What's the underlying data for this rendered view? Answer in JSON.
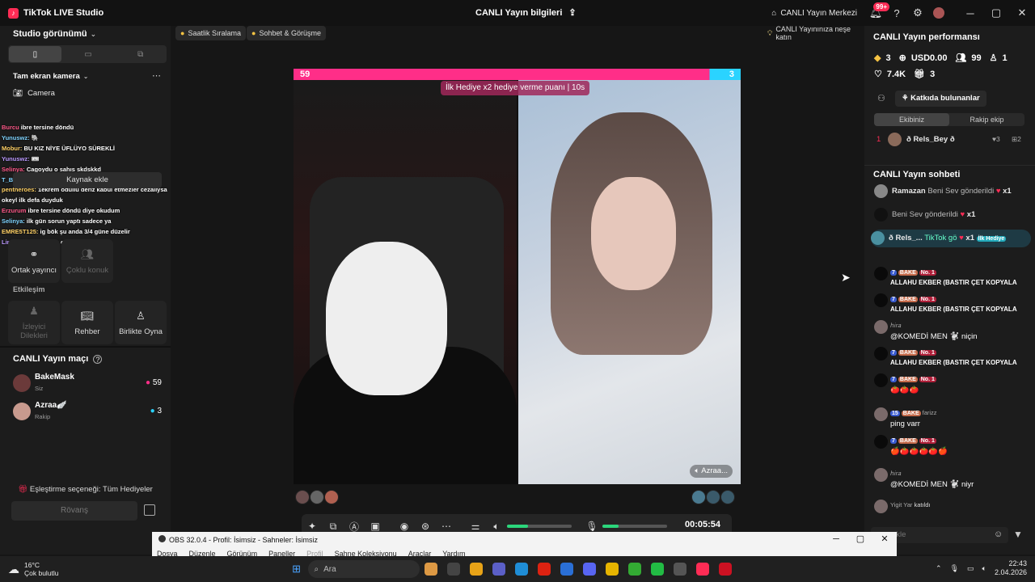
{
  "app": {
    "title": "TikTok LIVE Studio",
    "center_title": "CANLI Yayın bilgileri",
    "center_icon": "share-icon",
    "center_btn": "CANLI Yayın Merkezi",
    "notif_count": "99+"
  },
  "left": {
    "view_label": "Studio görünümü",
    "camera_section": "Tam ekran kamera",
    "camera_item": "Camera",
    "add_source": "Kaynak ekle",
    "chat_overlay": [
      {
        "user": "Burcu",
        "text": "ibre tersine döndü"
      },
      {
        "user": "Yunuswz:",
        "text": "🐘"
      },
      {
        "user": "Mobur:",
        "text": "BU KIZ NİYE ÜFLÜYO SÜREKLİ"
      },
      {
        "user": "Yunuswz:",
        "text": "🎟"
      },
      {
        "user": "Selinya:",
        "text": "Cagoydu o sahıs skdskkd"
      },
      {
        "user": "T_Bag!",
        "text": "🎟"
      },
      {
        "user": "pentheroes:",
        "text": "1ekrem ödüllü deriz kabul etmezler cezalıysa"
      },
      {
        "user": "",
        "text": "okeyl ilk defa duyduk"
      },
      {
        "user": "Erzurum",
        "text": "ibre tersine döndü diye okudum"
      },
      {
        "user": "Selinya:",
        "text": "ilk gün sorun yaptı sadece ya"
      },
      {
        "user": "EMRE5T125:",
        "text": "ig bök şu anda 3/4 güne düzelir"
      },
      {
        "user": "Linos61:",
        "text": "kovamayız o zamn"
      }
    ],
    "tiles_row1": [
      {
        "label": "Ortak yayıncı",
        "icon": "link-icon"
      },
      {
        "label": "Çoklu konuk",
        "icon": "multi-guest-icon"
      }
    ],
    "interaction_title": "Etkileşim",
    "tiles_row2": [
      {
        "label": "İzleyici Dilekleri",
        "icon": "wish-icon"
      },
      {
        "label": "Rehber",
        "icon": "book-icon"
      },
      {
        "label": "Birlikte Oyna",
        "icon": "play-together-icon"
      }
    ],
    "match_title": "CANLI Yayın maçı",
    "players": [
      {
        "name": "BakeMask",
        "role": "Siz",
        "score": "59"
      },
      {
        "name": "Azraa🪽",
        "role": "Rakip",
        "score": "3"
      }
    ],
    "match_option": "Eşleştirme seçeneği: Tüm Hediyeler",
    "rematch": "Rövanş"
  },
  "top_chips": [
    {
      "label": "Saatlik Sıralama",
      "icon": "crown-icon"
    },
    {
      "label": "Sohbet & Görüşme",
      "icon": "chat-icon"
    }
  ],
  "tip_chip": "CANLI Yayınınıza neşe katın",
  "stage": {
    "score_left": "59",
    "score_right": "3",
    "gift_banner": "İlk Hediye x2 hediye verme puanı | 10s",
    "guest_label": "Azraa..."
  },
  "control": {
    "timer": "00:05:54",
    "volume": 0.33,
    "mic": 0.25
  },
  "right": {
    "perf_title": "CANLI Yayın performansı",
    "stats_row1": [
      {
        "icon": "diamond-icon",
        "value": "3"
      },
      {
        "icon": "coin-icon",
        "value": "USD0.00"
      },
      {
        "icon": "viewers-icon",
        "value": "99"
      },
      {
        "icon": "follower-icon",
        "value": "1"
      }
    ],
    "stats_row2": [
      {
        "icon": "heart-icon",
        "value": "7.4K"
      },
      {
        "icon": "gift-icon",
        "value": "3"
      }
    ],
    "contrib_btn": "Katkıda bulunanlar",
    "team_tabs": [
      "Ekibiniz",
      "Rakip ekip"
    ],
    "contributor": {
      "rank": "1",
      "name": "ð Rels_Bey ð",
      "likes": "3",
      "gifts": "2"
    },
    "chat_title": "CANLI Yayın sohbeti",
    "gift_feed": [
      {
        "user": "Ramazan",
        "text": "Beni Sev gönderildi",
        "count": "x1"
      },
      {
        "user": "",
        "text": "Beni Sev gönderildi",
        "count": "x1"
      },
      {
        "user": "ð Rels_...",
        "text": "TikTok gö",
        "count": "x1",
        "tag": "İlk Hediye"
      }
    ],
    "messages": [
      {
        "level": "7",
        "team": "BAKE",
        "rank": "No. 1",
        "text": "ALLAHU EKBER (BASTIR ÇET KOPYALA"
      },
      {
        "level": "7",
        "team": "BAKE",
        "rank": "No. 1",
        "text": "ALLAHU EKBER (BASTIR ÇET KOPYALA"
      },
      {
        "user": "ℎ𝑖𝑟𝑎",
        "text": "@KOMEDİ MEN 🐩 niçin"
      },
      {
        "level": "7",
        "team": "BAKE",
        "rank": "No. 1",
        "text": "ALLAHU EKBER (BASTIR ÇET KOPYALA"
      },
      {
        "level": "7",
        "team": "BAKE",
        "rank": "No. 1",
        "text": "🍅🍅🍅"
      },
      {
        "level": "15",
        "team": "BAKE",
        "user": "farizz",
        "text": "ping varr"
      },
      {
        "level": "7",
        "team": "BAKE",
        "rank": "No. 1",
        "text": "🍎🍅🍅🍅🍅🍎"
      },
      {
        "user": "ℎ𝑖𝑟𝑎",
        "text": "@KOMEDİ MEN 🐩 niyr"
      },
      {
        "user": "Yigit Yar",
        "text": "katıldı"
      }
    ],
    "input_placeholder": "ekle"
  },
  "obs": {
    "title": "OBS 32.0.4 - Profil: İsimsiz - Sahneler: İsimsiz",
    "menu": [
      "Dosya",
      "Düzenle",
      "Görünüm",
      "Paneller",
      "Profil",
      "Sahne Koleksiyonu",
      "Araçlar",
      "Yardım"
    ]
  },
  "taskbar": {
    "weather_temp": "16°C",
    "weather_text": "Çok bulutlu",
    "search": "Ara",
    "time": "22:43",
    "date": "2.04.2026"
  },
  "colors": {
    "accent": "#fe2c55",
    "team_left": "#ff2e88",
    "team_right": "#2ad3ff",
    "green": "#2bd67b"
  }
}
